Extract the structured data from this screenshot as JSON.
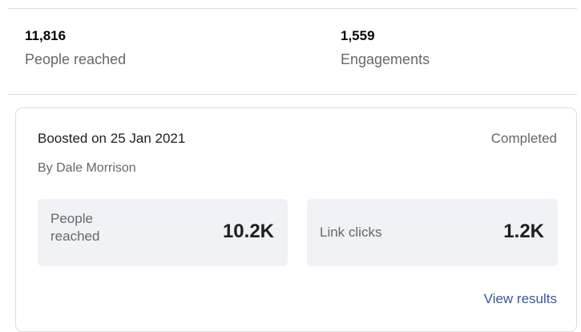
{
  "summary": {
    "people_reached_value": "11,816",
    "people_reached_label": "People reached",
    "engagements_value": "1,559",
    "engagements_label": "Engagements"
  },
  "boost": {
    "date_text": "Boosted on 25 Jan 2021",
    "by_text": "By Dale Morrison",
    "status": "Completed",
    "metrics": [
      {
        "label": "People reached",
        "value": "10.2K"
      },
      {
        "label": "Link clicks",
        "value": "1.2K"
      }
    ],
    "view_results_label": "View results"
  },
  "colors": {
    "text_primary": "#050505",
    "text_secondary": "#65676b",
    "link": "#385898",
    "metric_bg": "#f0f2f5",
    "border": "#dadde1"
  }
}
